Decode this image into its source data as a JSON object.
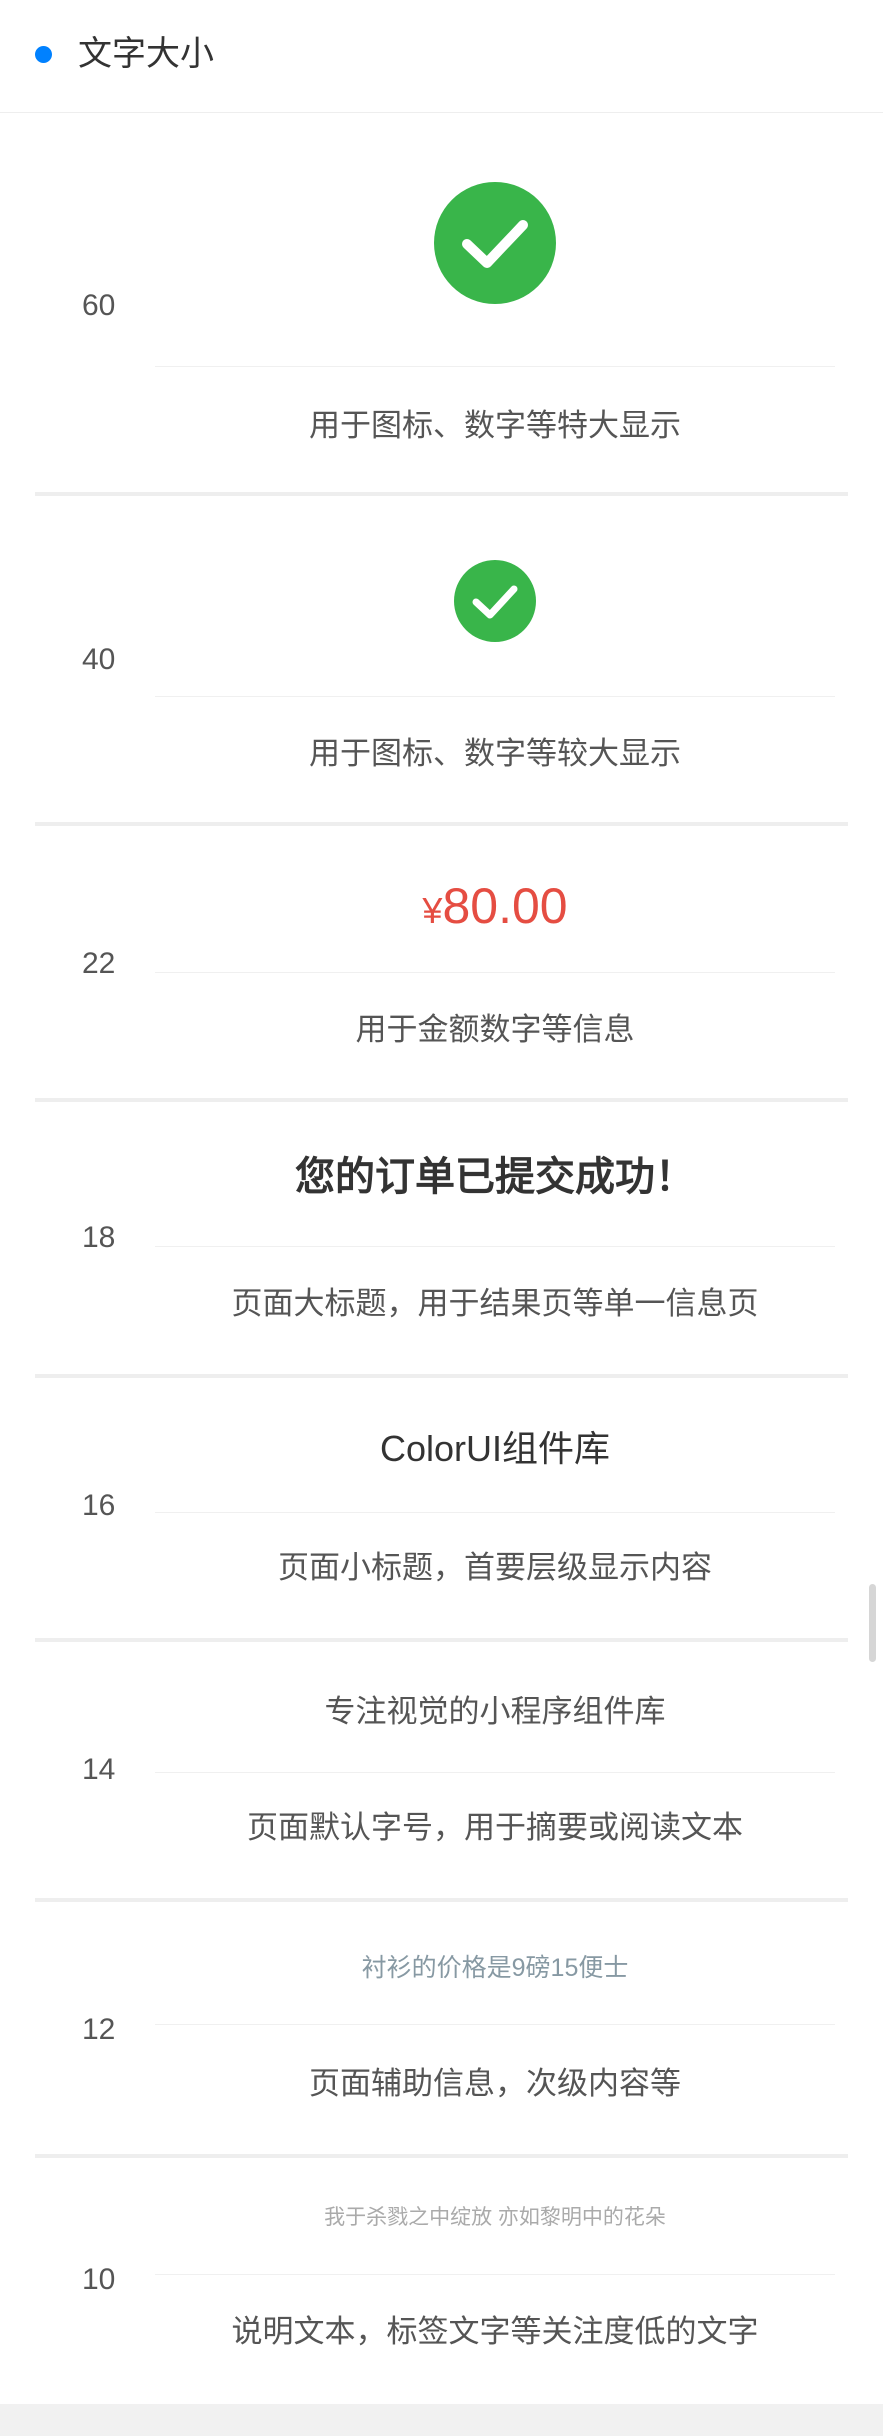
{
  "header": {
    "title": "文字大小"
  },
  "colors": {
    "accent": "#0081ff",
    "success": "#39b54a",
    "price": "#e54d42",
    "muted": "#8799a3",
    "gray": "#aaaaaa"
  },
  "sizes": [
    {
      "size": "60",
      "sample_icon": "check-circle-icon",
      "desc": "用于图标、数字等特大显示"
    },
    {
      "size": "40",
      "sample_icon": "check-circle-icon",
      "desc": "用于图标、数字等较大显示"
    },
    {
      "size": "22",
      "sample_currency": "¥",
      "sample_amount": "80.00",
      "desc": "用于金额数字等信息"
    },
    {
      "size": "18",
      "sample": "您的订单已提交成功！",
      "desc": "页面大标题，用于结果页等单一信息页"
    },
    {
      "size": "16",
      "sample": "ColorUI组件库",
      "desc": "页面小标题，首要层级显示内容"
    },
    {
      "size": "14",
      "sample": "专注视觉的小程序组件库",
      "desc": "页面默认字号，用于摘要或阅读文本"
    },
    {
      "size": "12",
      "sample": "衬衫的价格是9磅15便士",
      "desc": "页面辅助信息，次级内容等"
    },
    {
      "size": "10",
      "sample": "我于杀戮之中绽放 亦如黎明中的花朵",
      "desc": "说明文本，标签文字等关注度低的文字"
    }
  ]
}
